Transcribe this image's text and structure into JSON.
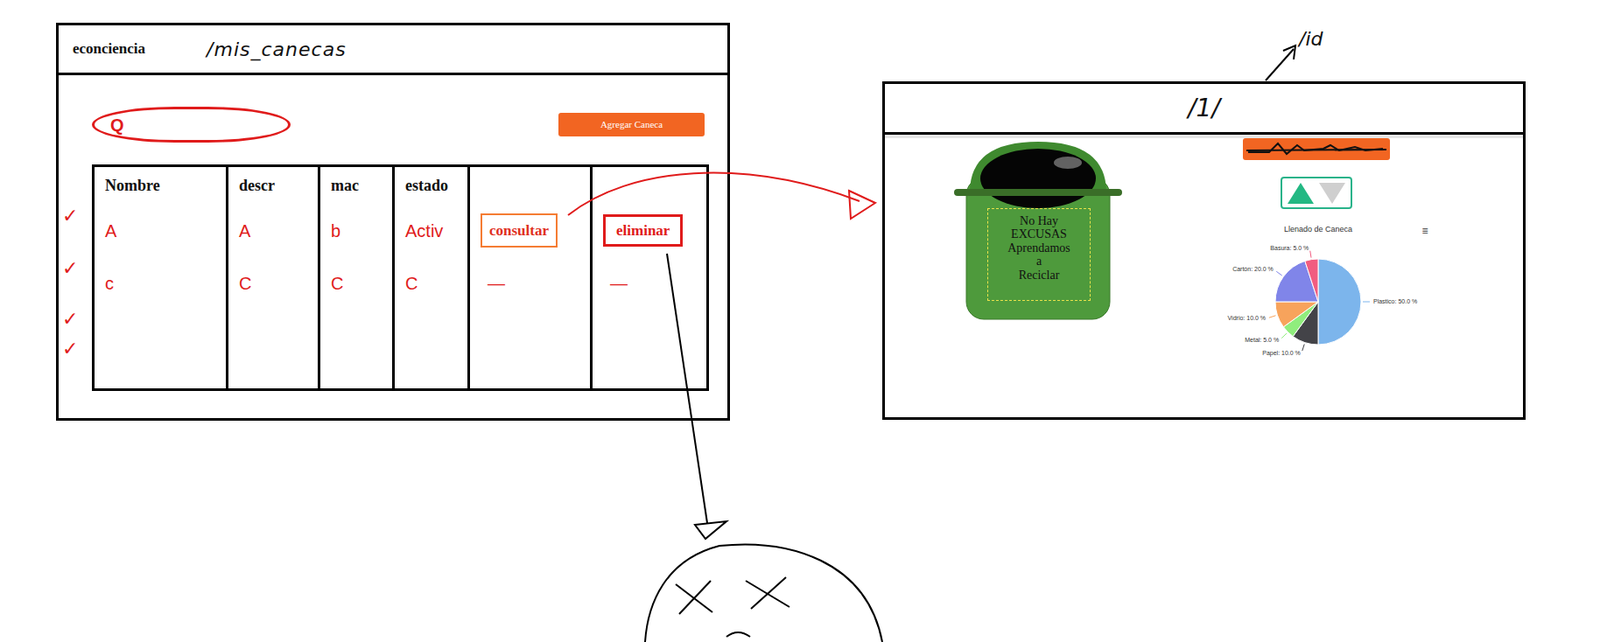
{
  "left_window": {
    "brand": "econciencia",
    "route": "/mis_canecas",
    "search": {
      "icon": "Q"
    },
    "add_button": "Agregar Caneca",
    "table": {
      "columns": [
        "Nombre",
        "descr",
        "mac",
        "estado"
      ],
      "rows": [
        {
          "cells": [
            "A",
            "A",
            "b",
            "Activ"
          ],
          "actions": [
            "consultar",
            "eliminar"
          ],
          "kind": "buttons"
        },
        {
          "cells": [
            "c",
            "C",
            "C",
            "C"
          ],
          "actions": [
            "—",
            "—"
          ],
          "kind": "dashes"
        }
      ]
    },
    "row_ticks": [
      "✓",
      "✓",
      "✓",
      "✓"
    ]
  },
  "right_window": {
    "route": "/1/",
    "route_note": "/id",
    "bin_text": [
      "No Hay",
      "EXCUSAS",
      "Aprendamos",
      "a",
      "Reciclar"
    ],
    "sort_toggle": [
      {
        "kind": "up",
        "selected": true
      },
      {
        "kind": "down",
        "selected": false
      }
    ],
    "chart": {
      "title": "Llenado de Caneca",
      "menu": "≡",
      "slices": [
        {
          "label": "Plastico: 50.0 %",
          "value": 50,
          "color": "#7cb5ec"
        },
        {
          "label": "Papel: 10.0 %",
          "value": 10,
          "color": "#434348"
        },
        {
          "label": "Metal: 5.0 %",
          "value": 5,
          "color": "#90ed7d"
        },
        {
          "label": "Vidrio: 10.0 %",
          "value": 10,
          "color": "#f7a35c"
        },
        {
          "label": "Cartón: 20.0 %",
          "value": 20,
          "color": "#8085e9"
        },
        {
          "label": "Basura: 5.0 %",
          "value": 5,
          "color": "#f15c80"
        }
      ]
    }
  }
}
